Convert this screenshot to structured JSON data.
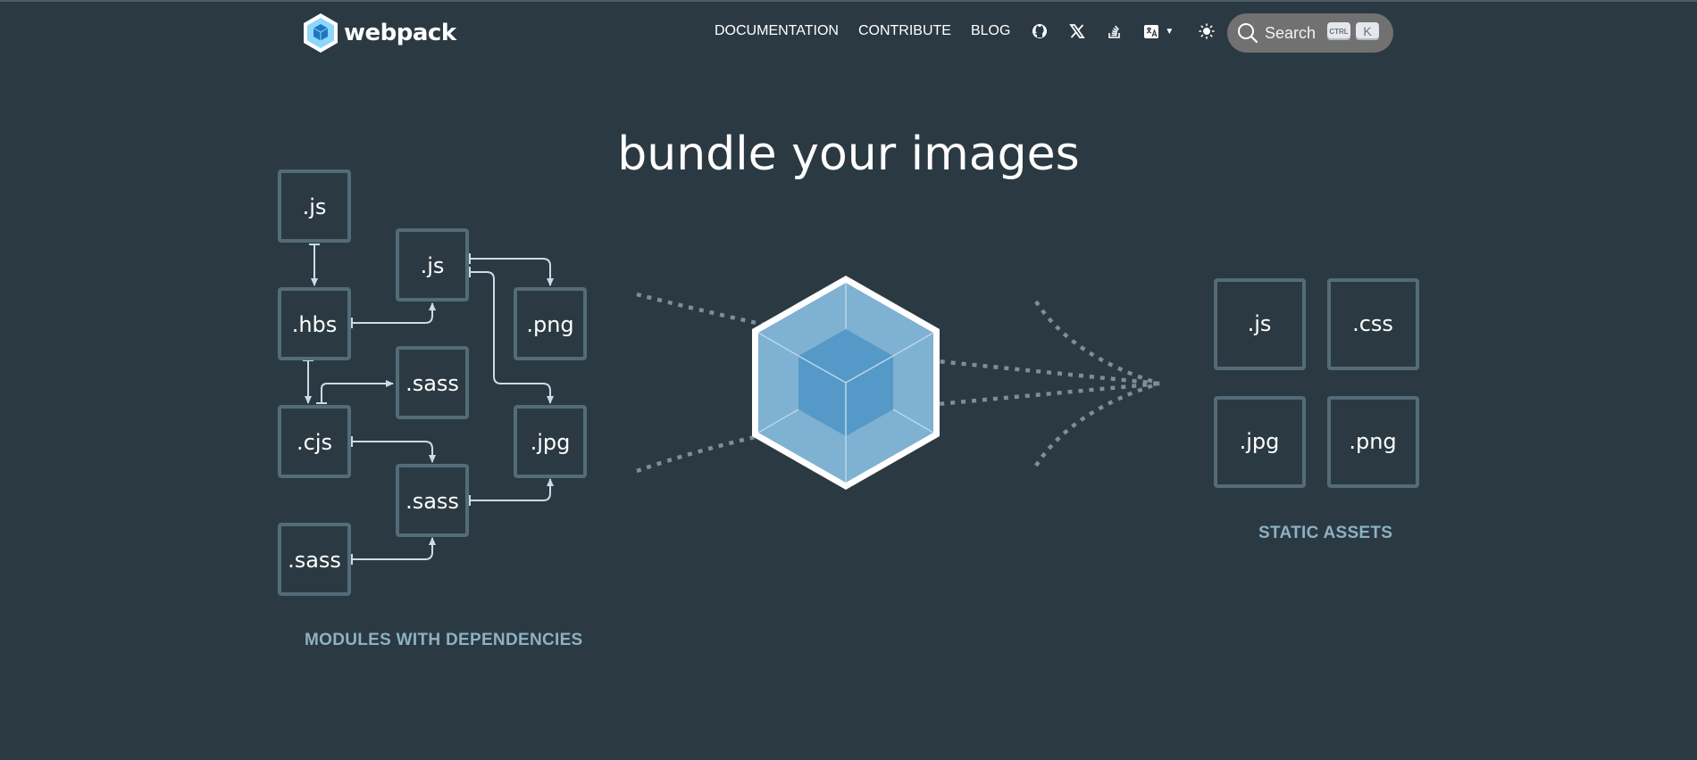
{
  "header": {
    "logo_text": "webpack",
    "nav": [
      "DOCUMENTATION",
      "CONTRIBUTE",
      "BLOG"
    ],
    "icons": [
      "github-icon",
      "x-twitter-icon",
      "stackoverflow-icon",
      "language-icon",
      "theme-toggle-icon"
    ],
    "search": {
      "label": "Search",
      "shortcut_modifier": "CTRL",
      "shortcut_key": "K"
    }
  },
  "hero": {
    "title": "bundle your images",
    "modules": {
      "caption": "MODULES WITH DEPENDENCIES",
      "items": [
        ".js",
        ".hbs",
        ".cjs",
        ".sass",
        ".js",
        ".sass",
        ".sass",
        ".png",
        ".jpg"
      ]
    },
    "assets": {
      "caption": "STATIC ASSETS",
      "items": [
        ".js",
        ".css",
        ".jpg",
        ".png"
      ]
    }
  },
  "colors": {
    "background": "#2b3a42",
    "box_stroke": "#546b78",
    "arrow": "#c8dde8",
    "caption": "#8eb0c4",
    "cube_light": "#8ed6fb",
    "cube_dark": "#1c78c0"
  }
}
